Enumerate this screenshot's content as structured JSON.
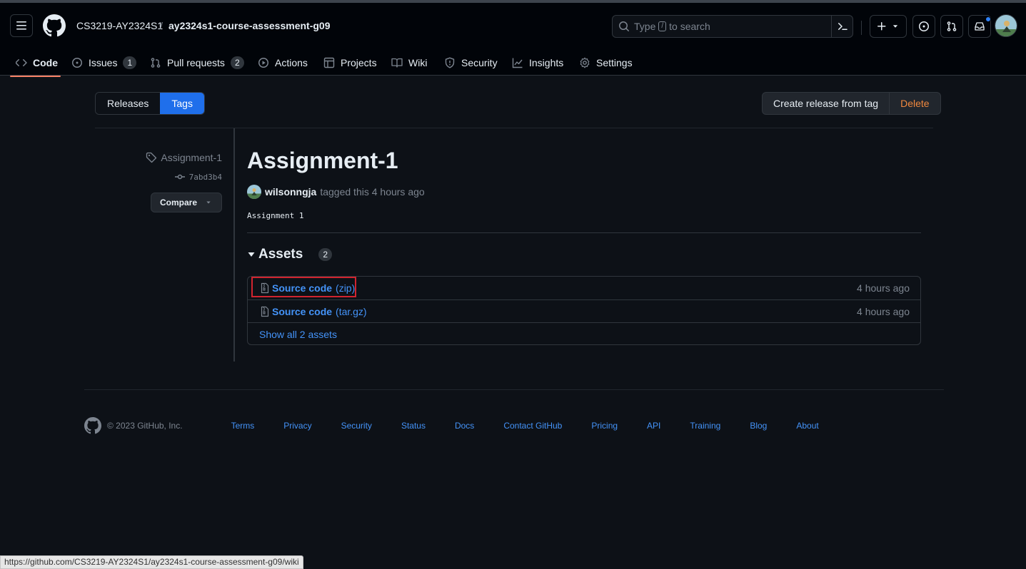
{
  "header": {
    "owner": "CS3219-AY2324S1",
    "separator": "/",
    "repo": "ay2324s1-course-assessment-g09",
    "search_prefix": "Type",
    "search_slash": "/",
    "search_suffix": "to search"
  },
  "nav": {
    "code": "Code",
    "issues": "Issues",
    "issues_count": "1",
    "pulls": "Pull requests",
    "pulls_count": "2",
    "actions": "Actions",
    "projects": "Projects",
    "wiki": "Wiki",
    "security": "Security",
    "insights": "Insights",
    "settings": "Settings"
  },
  "subnav": {
    "releases": "Releases",
    "tags": "Tags"
  },
  "actions": {
    "create_release": "Create release from tag",
    "delete": "Delete"
  },
  "tag": {
    "name": "Assignment-1",
    "sha": "7abd3b4",
    "compare": "Compare"
  },
  "release": {
    "title": "Assignment-1",
    "author": "wilsonngja",
    "tagged_text": "tagged this 4 hours ago",
    "body": "Assignment 1"
  },
  "assets": {
    "heading": "Assets",
    "count": "2",
    "rows": [
      {
        "name_bold": "Source code",
        "name_suffix": "(zip)",
        "time": "4 hours ago"
      },
      {
        "name_bold": "Source code",
        "name_suffix": "(tar.gz)",
        "time": "4 hours ago"
      }
    ],
    "show_all": "Show all 2 assets"
  },
  "footer": {
    "copyright": "© 2023 GitHub, Inc.",
    "links": [
      "Terms",
      "Privacy",
      "Security",
      "Status",
      "Docs",
      "Contact GitHub",
      "Pricing",
      "API",
      "Training",
      "Blog",
      "About"
    ]
  },
  "status_bar": {
    "url": "https://github.com/CS3219-AY2324S1/ay2324s1-course-assessment-g09/wiki"
  },
  "colors": {
    "accent": "#4493f8",
    "selected_tab": "#1f6feb",
    "danger": "#f0883e",
    "underline": "#f78166",
    "highlight": "#d1242f"
  }
}
